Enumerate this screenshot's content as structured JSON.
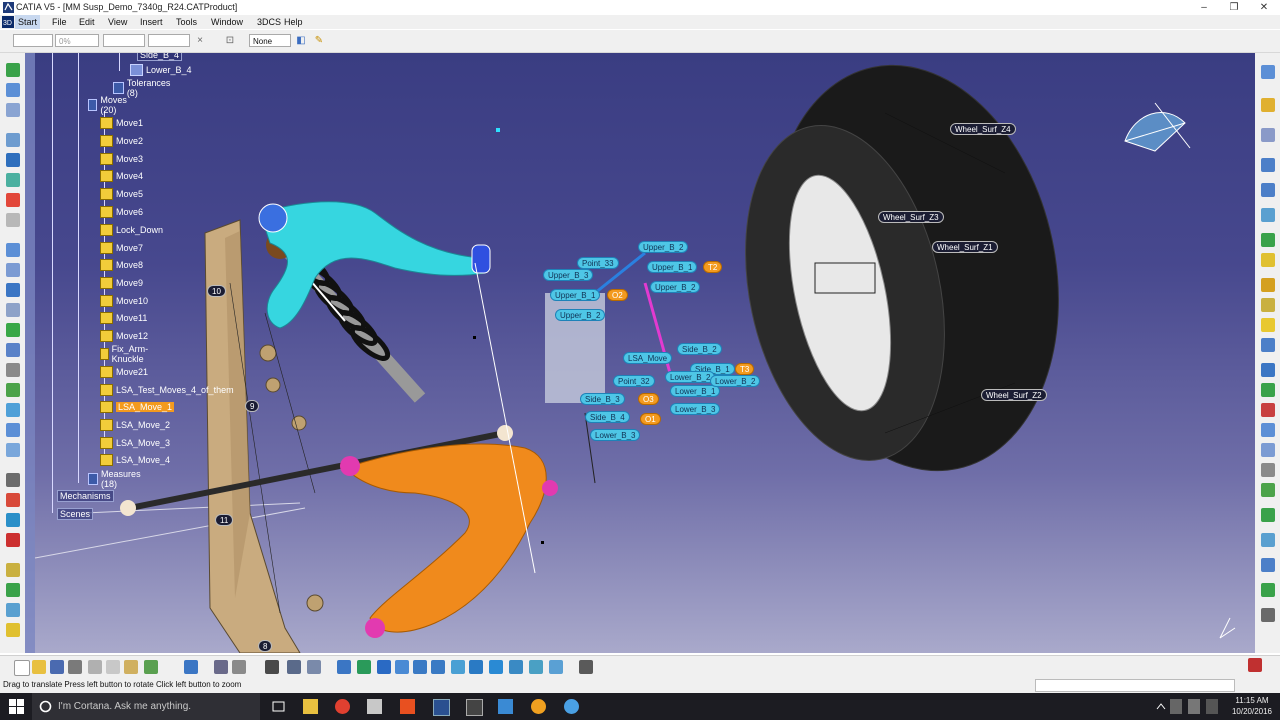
{
  "window": {
    "title": "CATIA V5 - [MM Susp_Demo_7340g_R24.CATProduct]",
    "controls": [
      "–",
      "❐",
      "✕"
    ]
  },
  "menu": [
    "Start",
    "File",
    "Edit",
    "View",
    "Insert",
    "Tools",
    "Window",
    "3DCS",
    "Help"
  ],
  "toolbar": {
    "opacity_value": "0%",
    "none_value": "None"
  },
  "tree": {
    "partial_node": "Side_B_4",
    "lower_b4": "Lower_B_4",
    "tolerances": "Tolerances (8)",
    "moves_folder": "Moves (20)",
    "moves": [
      "Move1",
      "Move2",
      "Move3",
      "Move4",
      "Move5",
      "Move6",
      "Lock_Down",
      "Move7",
      "Move8",
      "Move9",
      "Move10",
      "Move11",
      "Move12",
      "Fix_Arm-Knuckle",
      "Move21",
      "LSA_Test_Moves_4_of_them",
      "LSA_Move_1",
      "LSA_Move_2",
      "LSA_Move_3",
      "LSA_Move_4"
    ],
    "selected_move": "LSA_Move_1",
    "measures": "Measures (18)",
    "mechanisms": "Mechanisms",
    "scenes": "Scenes"
  },
  "model_labels": {
    "wheel": [
      "Wheel_Surf_Z4",
      "Wheel_Surf_Z3",
      "Wheel_Surf_Z1",
      "Wheel_Surf_Z2"
    ],
    "points": [
      "Point_33",
      "Upper_B_3",
      "Upper_B_1",
      "Upper_B_2",
      "Upper_B_2",
      "Upper_B_1",
      "Upper_B_2",
      "LSA_Move",
      "Side_B_2",
      "Side_B_1",
      "Point_32",
      "Lower_B_2",
      "Lower_B_1",
      "Side_B_3",
      "Lower_B_2",
      "Lower_B_3",
      "Lower_B_3",
      "Side_B_4"
    ],
    "tags": [
      "T2",
      "O2",
      "T3",
      "O3",
      "O1"
    ],
    "dim_tags": [
      "10",
      "9",
      "11",
      "8"
    ]
  },
  "status": {
    "text": "Drag to translate  Press left button to rotate  Click left button to zoom"
  },
  "taskbar": {
    "search_placeholder": "I'm Cortana. Ask me anything.",
    "time": "11:15 AM",
    "date": "10/20/2016"
  },
  "colors": {
    "background_top": "#3a3d82",
    "background_bottom": "#a9a9cb",
    "upper_arm": "#36d6e0",
    "lower_arm": "#f08a1c",
    "label_blue": "#4ec6e6",
    "selection": "#f39a1e"
  }
}
